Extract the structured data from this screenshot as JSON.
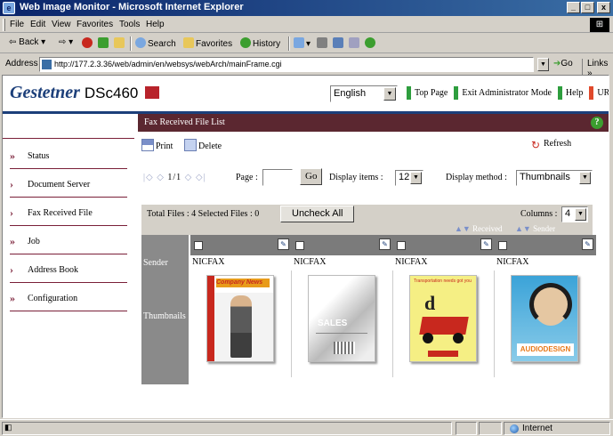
{
  "window": {
    "title": "Web Image Monitor - Microsoft Internet Explorer",
    "controls": {
      "minimize": "_",
      "maximize": "□",
      "close": "x"
    }
  },
  "menu": [
    "File",
    "Edit",
    "View",
    "Favorites",
    "Tools",
    "Help"
  ],
  "toolbar": {
    "back": "Back",
    "search": "Search",
    "favorites": "Favorites",
    "history": "History"
  },
  "address": {
    "label": "Address",
    "url": "http://177.2.3.36/web/admin/en/websys/webArch/mainFrame.cgi",
    "go": "Go",
    "links": "Links"
  },
  "header": {
    "brand": "Gestetner",
    "model": "DSc460",
    "language": "English",
    "links": [
      "Top Page",
      "Exit Administrator Mode",
      "Help",
      "URL"
    ]
  },
  "sidebar": {
    "items": [
      {
        "label": "Status",
        "arrow": "»"
      },
      {
        "label": "Document Server",
        "arrow": "›"
      },
      {
        "label": "Fax Received File",
        "arrow": "›"
      },
      {
        "label": "Job",
        "arrow": "»"
      },
      {
        "label": "Address Book",
        "arrow": "›"
      },
      {
        "label": "Configuration",
        "arrow": "»"
      }
    ]
  },
  "main": {
    "title": "Fax Received File List",
    "help": "?",
    "actions": {
      "print": "Print",
      "delete": "Delete",
      "refresh": "Refresh"
    },
    "pager": {
      "nav_left": "|◇ ◇",
      "page_count": "1/1",
      "nav_right": "◇ ◇|",
      "page_label": "Page :",
      "page_value": "",
      "go": "Go",
      "display_items_label": "Display items :",
      "display_items_value": "12",
      "display_method_label": "Display method :",
      "display_method_value": "Thumbnails"
    },
    "summary": {
      "text": "Total Files : 4   Selected Files : 0",
      "uncheck_all": "Uncheck All",
      "columns_label": "Columns :",
      "columns_value": "4"
    },
    "sort": {
      "received": "Received",
      "sender": "Sender"
    },
    "grid": {
      "row_labels": {
        "sender": "Sender",
        "thumbnails": "Thumbnails"
      },
      "files": [
        {
          "sender": "NICFAX",
          "thumb_text": "Company News"
        },
        {
          "sender": "NICFAX",
          "thumb_text": "SALES"
        },
        {
          "sender": "NICFAX",
          "thumb_text": "Transportation needs got you"
        },
        {
          "sender": "NICFAX",
          "thumb_text": "AUDIODESIGN"
        }
      ]
    }
  },
  "status": {
    "zone": "Internet"
  }
}
